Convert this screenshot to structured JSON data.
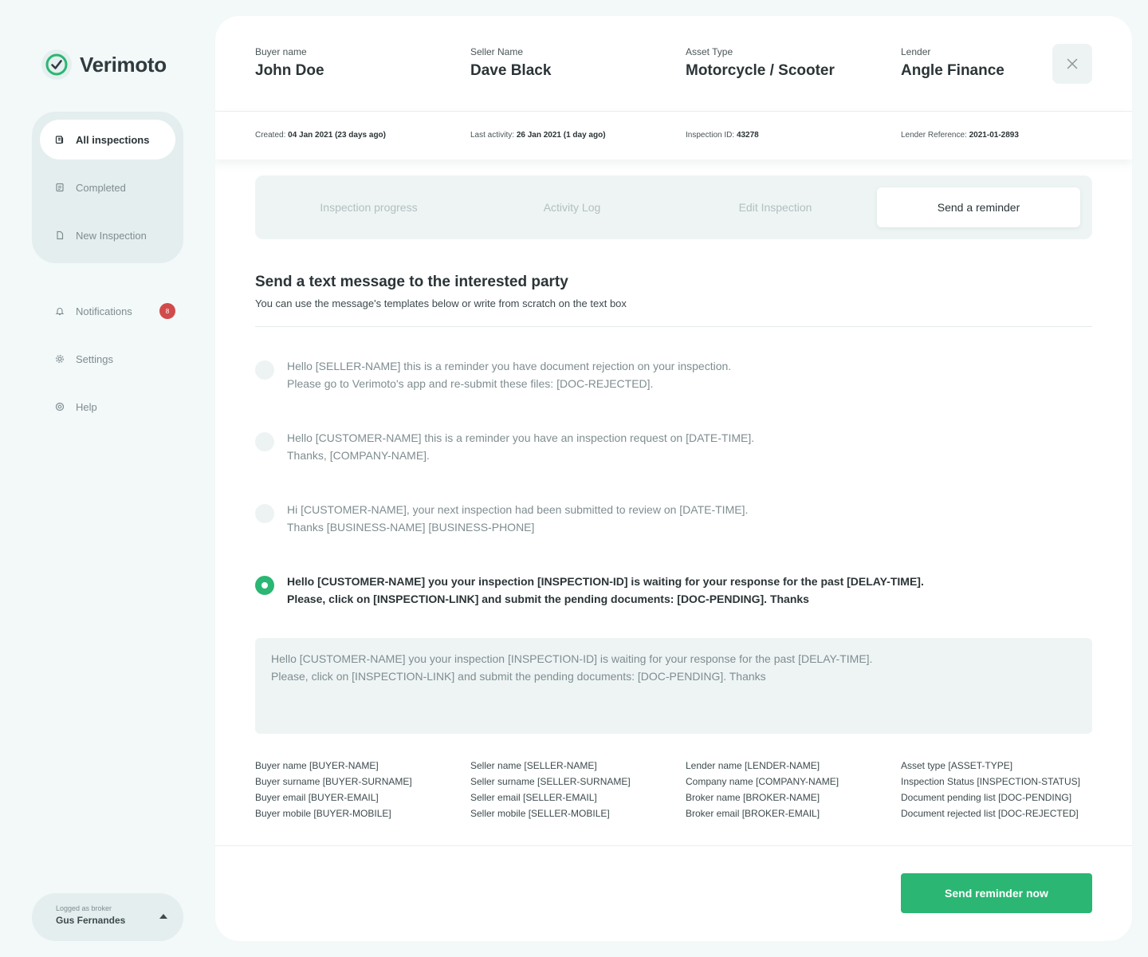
{
  "app": {
    "name": "Verimoto"
  },
  "sidebar": {
    "main_items": [
      {
        "label": "All inspections"
      },
      {
        "label": "Completed"
      },
      {
        "label": "New Inspection"
      }
    ],
    "notifications": {
      "label": "Notifications",
      "count": "8"
    },
    "settings": {
      "label": "Settings"
    },
    "help": {
      "label": "Help"
    },
    "user": {
      "caption": "Logged as broker",
      "name": "Gus Fernandes"
    }
  },
  "header": {
    "buyer": {
      "label": "Buyer name",
      "value": "John Doe"
    },
    "seller": {
      "label": "Seller Name",
      "value": "Dave Black"
    },
    "asset": {
      "label": "Asset Type",
      "value": "Motorcycle / Scooter"
    },
    "lender": {
      "label": "Lender",
      "value": "Angle Finance"
    }
  },
  "meta": {
    "created": {
      "label": "Created:",
      "value": "04 Jan 2021 (23 days ago)"
    },
    "last_activity": {
      "label": "Last activity:",
      "value": "26 Jan 2021 (1 day ago)"
    },
    "inspection_id": {
      "label": "Inspection ID:",
      "value": "43278"
    },
    "lender_ref": {
      "label": "Lender Reference:",
      "value": "2021-01-2893"
    }
  },
  "tabs": [
    {
      "label": "Inspection progress"
    },
    {
      "label": "Activity Log"
    },
    {
      "label": "Edit Inspection"
    },
    {
      "label": "Send a reminder"
    }
  ],
  "section": {
    "title": "Send a text message to the interested party",
    "subtitle": "You can use the message's templates below or write from scratch on the text box"
  },
  "templates": [
    {
      "line1": "Hello [SELLER-NAME] this is a reminder you have document rejection on your inspection.",
      "line2": "Please go to Verimoto's app and re-submit these files: [DOC-REJECTED]."
    },
    {
      "line1": "Hello [CUSTOMER-NAME] this is a reminder you have an inspection request on [DATE-TIME].",
      "line2": "Thanks, [COMPANY-NAME]."
    },
    {
      "line1": "Hi [CUSTOMER-NAME], your next inspection had been submitted to review on [DATE-TIME].",
      "line2": "Thanks [BUSINESS-NAME] [BUSINESS-PHONE]"
    },
    {
      "line1": "Hello [CUSTOMER-NAME] you your inspection [INSPECTION-ID] is waiting for your response for the past [DELAY-TIME].",
      "line2": "Please,  click on [INSPECTION-LINK] and submit the pending documents: [DOC-PENDING]. Thanks"
    }
  ],
  "message": {
    "line1": "Hello [CUSTOMER-NAME] you your inspection [INSPECTION-ID] is waiting for your response for the past [DELAY-TIME].",
    "line2": "Please,  click on [INSPECTION-LINK] and submit the pending documents: [DOC-PENDING]. Thanks"
  },
  "variables": [
    [
      "Buyer name [BUYER-NAME]",
      "Buyer surname [BUYER-SURNAME]",
      "Buyer email [BUYER-EMAIL]",
      "Buyer mobile [BUYER-MOBILE]"
    ],
    [
      "Seller name [SELLER-NAME]",
      "Seller surname [SELLER-SURNAME]",
      "Seller email [SELLER-EMAIL]",
      "Seller mobile [SELLER-MOBILE]"
    ],
    [
      "Lender name [LENDER-NAME]",
      "Company name [COMPANY-NAME]",
      "Broker name [BROKER-NAME]",
      "Broker email [BROKER-EMAIL]"
    ],
    [
      "Asset type [ASSET-TYPE]",
      "Inspection Status [INSPECTION-STATUS]",
      "Document pending list [DOC-PENDING]",
      "Document rejected list [DOC-REJECTED]"
    ]
  ],
  "actions": {
    "send_label": "Send reminder now"
  },
  "colors": {
    "accent": "#2bb673",
    "badge": "#d14b4b",
    "background": "#f3f8f8"
  }
}
